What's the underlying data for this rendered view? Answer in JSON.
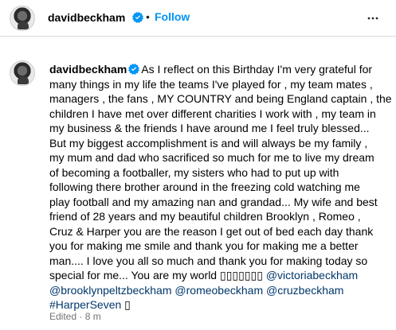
{
  "header": {
    "username": "davidbeckham",
    "separator": "•",
    "follow_label": "Follow",
    "verified": true,
    "more_icon": "more-horizontal-icon"
  },
  "caption": {
    "username": "davidbeckham",
    "lines": [
      "As I reflect on this Birthday I'm very grateful for",
      "many things in my life the teams I've played for , my team mates ,",
      "managers , the fans , MY COUNTRY and being England captain , the",
      "children I have met over different charities I work with , my team in",
      "my business & the friends I have around me I feel truly blessed...",
      "But my biggest accomplishment is and will always be my family ,",
      "my mum and dad who sacrificed so much for me to live my dream",
      "of becoming a footballer, my sisters who had to put up with",
      "following there brother around in the freezing cold watching me",
      "play football and my amazing nan and grandad... My wife and best",
      "friend of 28 years and my beautiful children Brooklyn , Romeo ,",
      "Cruz & Harper you are the reason I get out of bed each day thank",
      "you for making me smile and thank you for making me a better",
      "man.... I love you all so much and thank you for making today so"
    ],
    "last_line_text": "special for me... You are my world ",
    "emoji_run": "▯▯▯▯▯▯▯",
    "mentions": [
      "@victoriabeckham",
      "@brooklynpeltzbeckham",
      "@romeobeckham",
      "@cruzbeckham"
    ],
    "hashtag": "#HarperSeven",
    "trailing_emoji": "▯"
  },
  "meta": {
    "edited_label": "Edited",
    "separator": "·",
    "time_ago": "8 m"
  },
  "colors": {
    "follow": "#0095f6",
    "link": "#00376b",
    "meta": "#737373",
    "verified": "#0095f6"
  }
}
